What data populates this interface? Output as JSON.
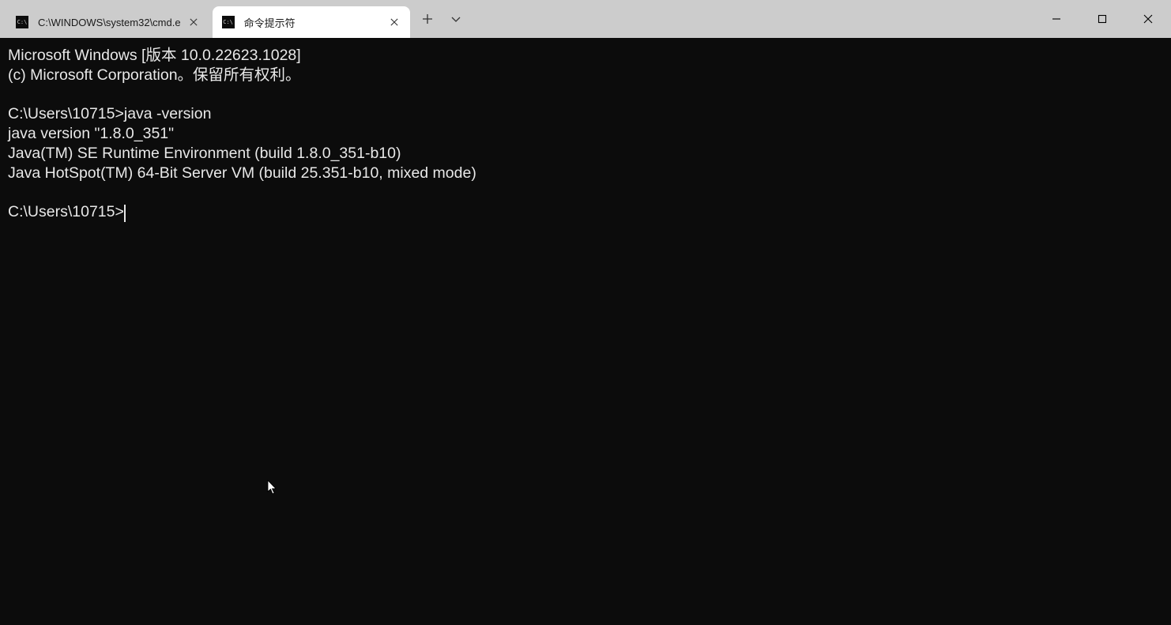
{
  "tabs": [
    {
      "title": "C:\\WINDOWS\\system32\\cmd.e",
      "active": false
    },
    {
      "title": "命令提示符",
      "active": true
    }
  ],
  "terminal": {
    "lines": [
      "Microsoft Windows [版本 10.0.22623.1028]",
      "(c) Microsoft Corporation。保留所有权利。",
      "",
      "C:\\Users\\10715>java -version",
      "java version \"1.8.0_351\"",
      "Java(TM) SE Runtime Environment (build 1.8.0_351-b10)",
      "Java HotSpot(TM) 64-Bit Server VM (build 25.351-b10, mixed mode)",
      ""
    ],
    "prompt": "C:\\Users\\10715>"
  }
}
